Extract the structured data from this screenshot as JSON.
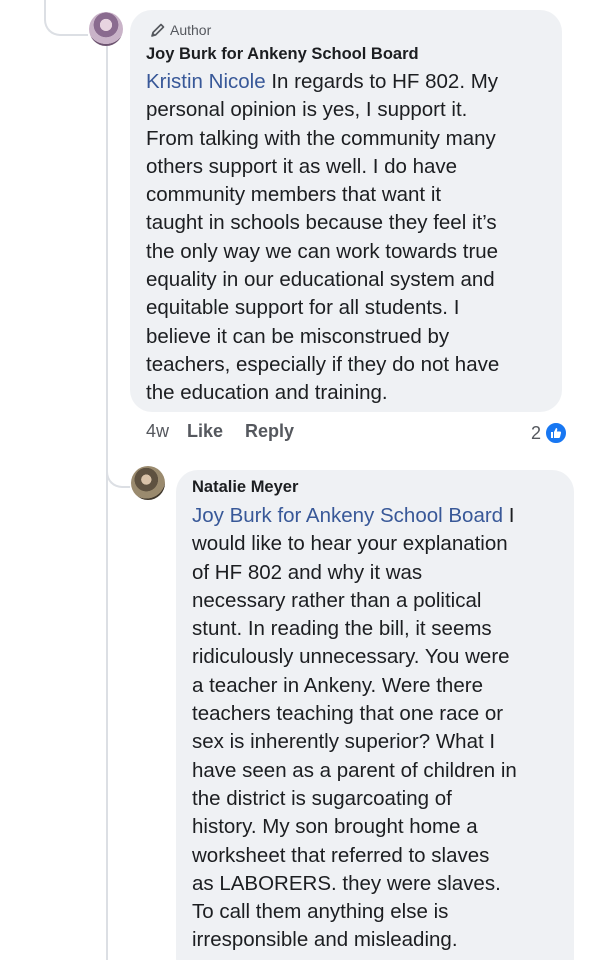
{
  "thread": {
    "comment1": {
      "badge": "Author",
      "author": "Joy Burk for Ankeny School Board",
      "mention": "Kristin Nicole",
      "lines": [
        " In regards to HF 802. My",
        "personal opinion is yes, I support it.",
        "From talking with the community many",
        "others support it as well. I do have",
        "community members that want it",
        "taught in schools because they feel it’s",
        "the only way we can work towards true",
        "equality in our educational system and",
        "equitable support for all students. I",
        "believe it can be misconstrued by",
        "teachers, especially if they do not have",
        "the education and training."
      ],
      "time": "4w",
      "like_label": "Like",
      "reply_label": "Reply",
      "reaction_count": "2"
    },
    "comment2": {
      "author": "Natalie Meyer",
      "mention": "Joy Burk for Ankeny School Board",
      "lines": [
        " I",
        "would like to hear your explanation",
        "of HF 802 and why it was",
        "necessary rather than a political",
        "stunt. In reading the bill, it seems",
        "ridiculously unnecessary. You were",
        "a teacher in Ankeny. Were there",
        "teachers teaching that one race or",
        "sex is inherently superior? What I",
        "have seen as a parent of children in",
        "the district is sugarcoating of",
        "history. My son brought home a",
        "worksheet that referred to slaves",
        "as LABORERS. they were slaves.",
        "To call them anything else is",
        "irresponsible and misleading."
      ]
    }
  },
  "colors": {
    "bubble": "#eff1f4",
    "mention": "#385898",
    "text": "#1c1e21",
    "meta": "#55585e",
    "like_reaction": "#1877f2"
  },
  "icons": {
    "badge": "pencil-icon",
    "reaction": "like-reaction-icon"
  }
}
